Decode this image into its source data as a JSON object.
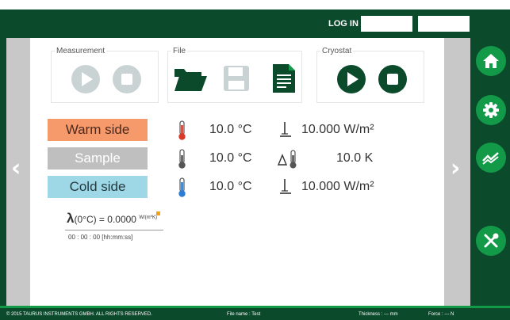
{
  "header": {
    "login_label": "LOG IN",
    "username_value": "",
    "password_value": ""
  },
  "toolbar": {
    "measurement": {
      "label": "Measurement",
      "play_icon": "play-icon",
      "stop_icon": "stop-icon",
      "state": "disabled"
    },
    "file": {
      "label": "File",
      "open_icon": "folder-open-icon",
      "save_icon": "save-icon",
      "report_icon": "document-icon"
    },
    "cryostat": {
      "label": "Cryostat",
      "play_icon": "play-icon",
      "stop_icon": "stop-icon",
      "state": "enabled"
    }
  },
  "sides": [
    {
      "label": "Warm side",
      "temperature": "10.0 °C",
      "flux": "10.000 W/m²",
      "color": "#f79a6b"
    },
    {
      "label": "Sample",
      "temperature": "10.0 °C",
      "delta": "10.0 K",
      "color": "#bfbfbf"
    },
    {
      "label": "Cold side",
      "temperature": "10.0 °C",
      "flux": "10.000 W/m²",
      "color": "#9ed8e6"
    }
  ],
  "lambda": {
    "symbol": "λ",
    "condition": "(0°C) = 0.0000",
    "unit": "W/(m*K)",
    "timer": "00  :  00  :  00  [hh:mm:ss]"
  },
  "nav": {
    "prev_icon": "chevron-left-icon",
    "next_icon": "chevron-right-icon",
    "home_icon": "home-icon",
    "settings_icon": "gear-icon",
    "chart_icon": "chart-icon",
    "tools_icon": "tools-icon"
  },
  "footer": {
    "copyright": "© 2015 TAURUS INSTRUMENTS GMBH. ALL RIGHTS RESERVED.",
    "file_name": "File name :  Test",
    "thickness": "Thickness :  ---  mm",
    "force": "Force :  ---  N"
  },
  "colors": {
    "brand_dark": "#0c4a2c",
    "brand_green": "#129a48",
    "disabled": "#c9d3d3"
  }
}
